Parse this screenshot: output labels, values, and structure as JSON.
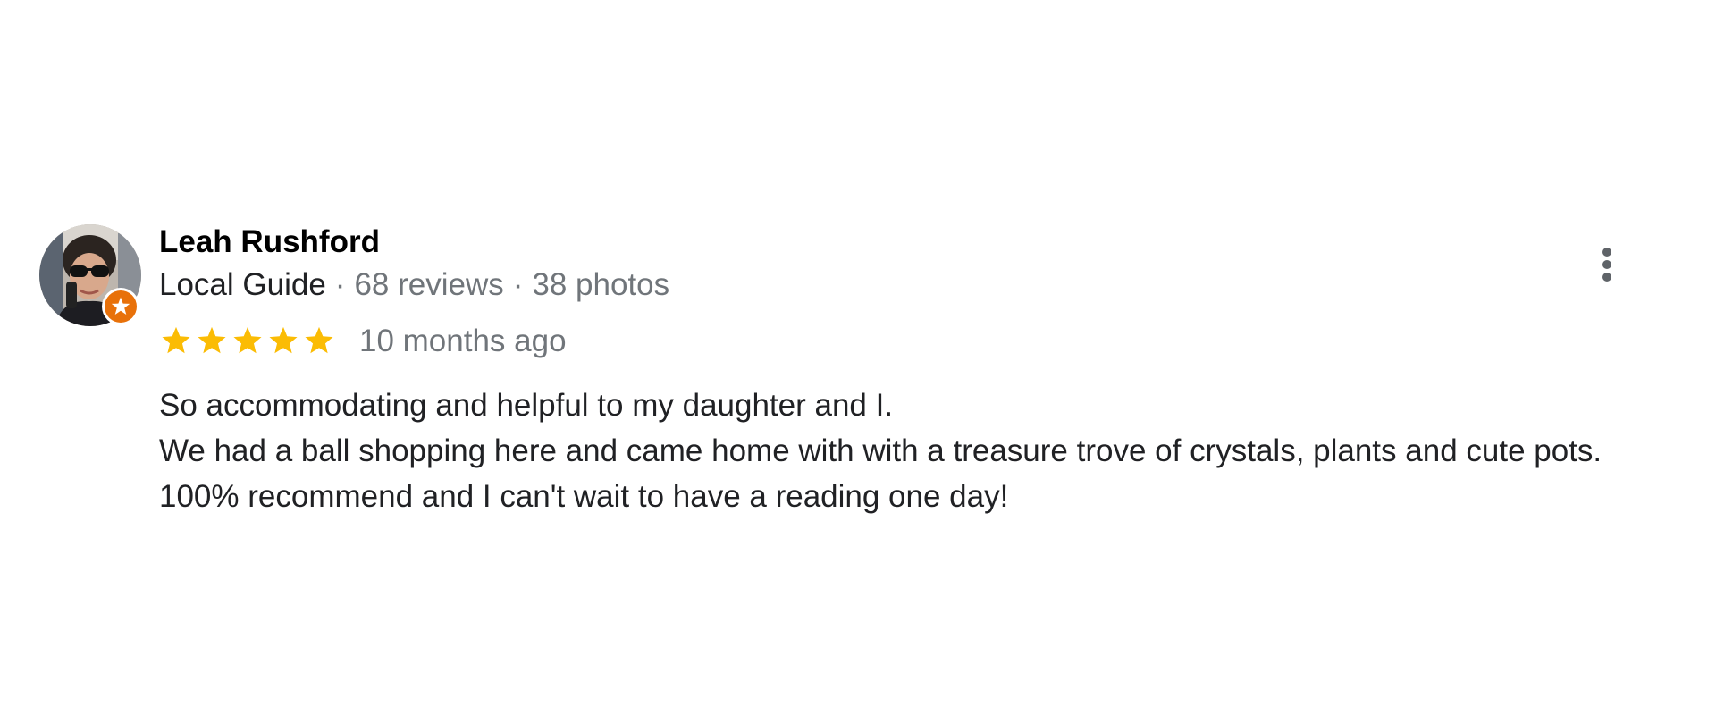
{
  "review": {
    "author": {
      "name": "Leah Rushford",
      "badge": "Local Guide",
      "separator": "·",
      "reviews_count": "68 reviews",
      "photos_count": "38 photos",
      "avatar_icon": "profile-photo",
      "badge_icon": "local-guide-star-badge"
    },
    "rating": {
      "stars": 5,
      "max_stars": 5,
      "color": "#fbbc04"
    },
    "date": "10 months ago",
    "text_lines": [
      "So accommodating and helpful to my daughter and I.",
      "We had a ball shopping here and came home with with a treasure trove of crystals, plants and cute pots.",
      "100% recommend and I can't wait to have a reading one day!"
    ],
    "menu_icon": "more-vert-icon"
  },
  "colors": {
    "name": "#000000",
    "meta": "#70757a",
    "body": "#202124",
    "badge": "#e8710a",
    "star": "#fbbc04"
  }
}
